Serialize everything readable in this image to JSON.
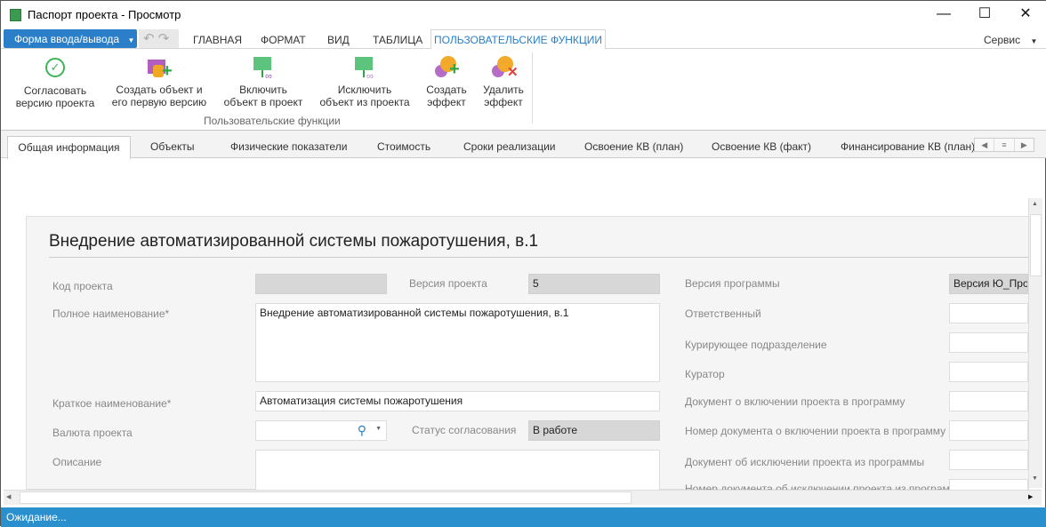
{
  "window": {
    "title": "Паспорт проекта - Просмотр",
    "minimize": "—",
    "maximize": "☐",
    "close": "✕"
  },
  "ribbon": {
    "form_button": "Форма ввода/вывода",
    "tabs": [
      "ГЛАВНАЯ",
      "ФОРМАТ",
      "ВИД",
      "ТАБЛИЦА",
      "ПОЛЬЗОВАТЕЛЬСКИЕ ФУНКЦИИ"
    ],
    "service": "Сервис",
    "buttons": [
      {
        "l1": "Согласовать",
        "l2": "версию проекта"
      },
      {
        "l1": "Создать объект и",
        "l2": "его первую версию"
      },
      {
        "l1": "Включить",
        "l2": "объект в проект"
      },
      {
        "l1": "Исключить",
        "l2": "объект из проекта"
      },
      {
        "l1": "Создать",
        "l2": "эффект"
      },
      {
        "l1": "Удалить",
        "l2": "эффект"
      }
    ],
    "group_label": "Пользовательские функции"
  },
  "page_tabs": [
    "Общая информация",
    "Объекты",
    "Физические показатели",
    "Стоимость",
    "Сроки реализации",
    "Освоение КВ (план)",
    "Освоение КВ (факт)",
    "Финансирование КВ (план)"
  ],
  "form": {
    "title": "Внедрение автоматизированной системы пожаротушения, в.1",
    "code_label": "Код проекта",
    "code_value": "",
    "version_label": "Версия проекта",
    "version_value": "5",
    "full_name_label": "Полное наименование*",
    "full_name_value": "Внедрение автоматизированной системы пожаротушения, в.1",
    "short_name_label": "Краткое наименование*",
    "short_name_value": "Автоматизация системы пожаротушения",
    "currency_label": "Валюта проекта",
    "currency_value": "",
    "status_label": "Статус согласования",
    "status_value": "В работе",
    "description_label": "Описание",
    "right": [
      {
        "label": "Версия программы",
        "value": "Версия Ю_Прог"
      },
      {
        "label": "Ответственный",
        "value": ""
      },
      {
        "label": "Курирующее подразделение",
        "value": ""
      },
      {
        "label": "Куратор",
        "value": ""
      },
      {
        "label": "Документ о включении проекта в программу",
        "value": ""
      },
      {
        "label": "Номер документа о включении проекта в программу",
        "value": ""
      },
      {
        "label": "Документ об исключении проекта из программы",
        "value": ""
      },
      {
        "label": "Номер документа об исключении проекта из программы",
        "value": ""
      }
    ]
  },
  "status_bar": "Ожидание..."
}
